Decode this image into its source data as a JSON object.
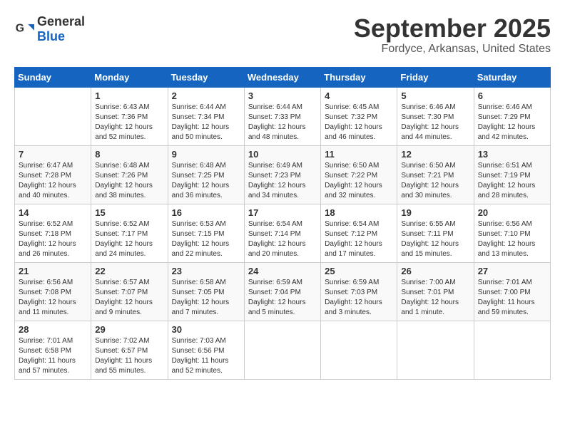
{
  "logo": {
    "general": "General",
    "blue": "Blue"
  },
  "title": "September 2025",
  "location": "Fordyce, Arkansas, United States",
  "weekdays": [
    "Sunday",
    "Monday",
    "Tuesday",
    "Wednesday",
    "Thursday",
    "Friday",
    "Saturday"
  ],
  "weeks": [
    [
      {
        "day": "",
        "info": ""
      },
      {
        "day": "1",
        "info": "Sunrise: 6:43 AM\nSunset: 7:36 PM\nDaylight: 12 hours\nand 52 minutes."
      },
      {
        "day": "2",
        "info": "Sunrise: 6:44 AM\nSunset: 7:34 PM\nDaylight: 12 hours\nand 50 minutes."
      },
      {
        "day": "3",
        "info": "Sunrise: 6:44 AM\nSunset: 7:33 PM\nDaylight: 12 hours\nand 48 minutes."
      },
      {
        "day": "4",
        "info": "Sunrise: 6:45 AM\nSunset: 7:32 PM\nDaylight: 12 hours\nand 46 minutes."
      },
      {
        "day": "5",
        "info": "Sunrise: 6:46 AM\nSunset: 7:30 PM\nDaylight: 12 hours\nand 44 minutes."
      },
      {
        "day": "6",
        "info": "Sunrise: 6:46 AM\nSunset: 7:29 PM\nDaylight: 12 hours\nand 42 minutes."
      }
    ],
    [
      {
        "day": "7",
        "info": "Sunrise: 6:47 AM\nSunset: 7:28 PM\nDaylight: 12 hours\nand 40 minutes."
      },
      {
        "day": "8",
        "info": "Sunrise: 6:48 AM\nSunset: 7:26 PM\nDaylight: 12 hours\nand 38 minutes."
      },
      {
        "day": "9",
        "info": "Sunrise: 6:48 AM\nSunset: 7:25 PM\nDaylight: 12 hours\nand 36 minutes."
      },
      {
        "day": "10",
        "info": "Sunrise: 6:49 AM\nSunset: 7:23 PM\nDaylight: 12 hours\nand 34 minutes."
      },
      {
        "day": "11",
        "info": "Sunrise: 6:50 AM\nSunset: 7:22 PM\nDaylight: 12 hours\nand 32 minutes."
      },
      {
        "day": "12",
        "info": "Sunrise: 6:50 AM\nSunset: 7:21 PM\nDaylight: 12 hours\nand 30 minutes."
      },
      {
        "day": "13",
        "info": "Sunrise: 6:51 AM\nSunset: 7:19 PM\nDaylight: 12 hours\nand 28 minutes."
      }
    ],
    [
      {
        "day": "14",
        "info": "Sunrise: 6:52 AM\nSunset: 7:18 PM\nDaylight: 12 hours\nand 26 minutes."
      },
      {
        "day": "15",
        "info": "Sunrise: 6:52 AM\nSunset: 7:17 PM\nDaylight: 12 hours\nand 24 minutes."
      },
      {
        "day": "16",
        "info": "Sunrise: 6:53 AM\nSunset: 7:15 PM\nDaylight: 12 hours\nand 22 minutes."
      },
      {
        "day": "17",
        "info": "Sunrise: 6:54 AM\nSunset: 7:14 PM\nDaylight: 12 hours\nand 20 minutes."
      },
      {
        "day": "18",
        "info": "Sunrise: 6:54 AM\nSunset: 7:12 PM\nDaylight: 12 hours\nand 17 minutes."
      },
      {
        "day": "19",
        "info": "Sunrise: 6:55 AM\nSunset: 7:11 PM\nDaylight: 12 hours\nand 15 minutes."
      },
      {
        "day": "20",
        "info": "Sunrise: 6:56 AM\nSunset: 7:10 PM\nDaylight: 12 hours\nand 13 minutes."
      }
    ],
    [
      {
        "day": "21",
        "info": "Sunrise: 6:56 AM\nSunset: 7:08 PM\nDaylight: 12 hours\nand 11 minutes."
      },
      {
        "day": "22",
        "info": "Sunrise: 6:57 AM\nSunset: 7:07 PM\nDaylight: 12 hours\nand 9 minutes."
      },
      {
        "day": "23",
        "info": "Sunrise: 6:58 AM\nSunset: 7:05 PM\nDaylight: 12 hours\nand 7 minutes."
      },
      {
        "day": "24",
        "info": "Sunrise: 6:59 AM\nSunset: 7:04 PM\nDaylight: 12 hours\nand 5 minutes."
      },
      {
        "day": "25",
        "info": "Sunrise: 6:59 AM\nSunset: 7:03 PM\nDaylight: 12 hours\nand 3 minutes."
      },
      {
        "day": "26",
        "info": "Sunrise: 7:00 AM\nSunset: 7:01 PM\nDaylight: 12 hours\nand 1 minute."
      },
      {
        "day": "27",
        "info": "Sunrise: 7:01 AM\nSunset: 7:00 PM\nDaylight: 11 hours\nand 59 minutes."
      }
    ],
    [
      {
        "day": "28",
        "info": "Sunrise: 7:01 AM\nSunset: 6:58 PM\nDaylight: 11 hours\nand 57 minutes."
      },
      {
        "day": "29",
        "info": "Sunrise: 7:02 AM\nSunset: 6:57 PM\nDaylight: 11 hours\nand 55 minutes."
      },
      {
        "day": "30",
        "info": "Sunrise: 7:03 AM\nSunset: 6:56 PM\nDaylight: 11 hours\nand 52 minutes."
      },
      {
        "day": "",
        "info": ""
      },
      {
        "day": "",
        "info": ""
      },
      {
        "day": "",
        "info": ""
      },
      {
        "day": "",
        "info": ""
      }
    ]
  ]
}
